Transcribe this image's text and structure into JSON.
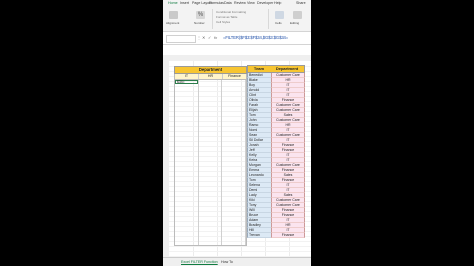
{
  "ribbon": {
    "tabs": [
      "Home",
      "Insert",
      "Page Layout",
      "Formulas",
      "Data",
      "Review",
      "View",
      "Developer",
      "Help"
    ],
    "share_label": "Share",
    "groups": {
      "number": "Number",
      "conditional_formatting": "Conditional Formatting",
      "format_as_table": "Format as Table",
      "cell_styles": "Cell Styles",
      "cells": "Cells",
      "editing": "Editing",
      "alignment": "Alignment"
    }
  },
  "formula_bar": {
    "cancel_glyph": "✕",
    "enter_glyph": "✓",
    "fx_label": "fx",
    "formula": "=FILTER($F$3:$F$34,$G$3:$G$34="
  },
  "left_table": {
    "title": "Department",
    "columns": [
      "IT",
      "HR",
      "Finance"
    ],
    "active_cell_value": "$34="
  },
  "right_table": {
    "headers": [
      "Team",
      "Department"
    ],
    "rows": [
      [
        "Benedict",
        "Customer Care"
      ],
      [
        "Blake",
        "HR"
      ],
      [
        "Boy",
        "IT"
      ],
      [
        "Arnold",
        "IT"
      ],
      [
        "Clint",
        "IT"
      ],
      [
        "Olivia",
        "Finance"
      ],
      [
        "Farah",
        "Customer Care"
      ],
      [
        "Elijah",
        "Customer Care"
      ],
      [
        "Tom",
        "Sales"
      ],
      [
        "John",
        "Customer Care"
      ],
      [
        "Ramo",
        "HR"
      ],
      [
        "Nomi",
        "IT"
      ],
      [
        "Sean",
        "Customer Care"
      ],
      [
        "Sil Dollar",
        "IT"
      ],
      [
        "Jonah",
        "Finance"
      ],
      [
        "Jeff",
        "Finance"
      ],
      [
        "Kelly",
        "IT"
      ],
      [
        "Keira",
        "IT"
      ],
      [
        "Morgan",
        "Customer Care"
      ],
      [
        "Emma",
        "Finance"
      ],
      [
        "Leonardo",
        "Sales"
      ],
      [
        "Tom",
        "Finance"
      ],
      [
        "Selena",
        "IT"
      ],
      [
        "Demi",
        "IT"
      ],
      [
        "Lady",
        "Sales"
      ],
      [
        "Kiki",
        "Customer Care"
      ],
      [
        "Tony",
        "Customer Care"
      ],
      [
        "Will",
        "Finance"
      ],
      [
        "Bruce",
        "Finance"
      ],
      [
        "Adam",
        "IT"
      ],
      [
        "Bradley",
        "HR"
      ],
      [
        "Hill",
        "IT"
      ],
      [
        "Trevan",
        "Finance"
      ]
    ]
  },
  "sheet_tabs": [
    "Excel FILTER Function",
    "How To"
  ],
  "colors": {
    "accent_green": "#107c41",
    "header_yellow": "#f7c531",
    "team_blue": "#dce9f5",
    "dept_pink": "#fbe4ef"
  }
}
